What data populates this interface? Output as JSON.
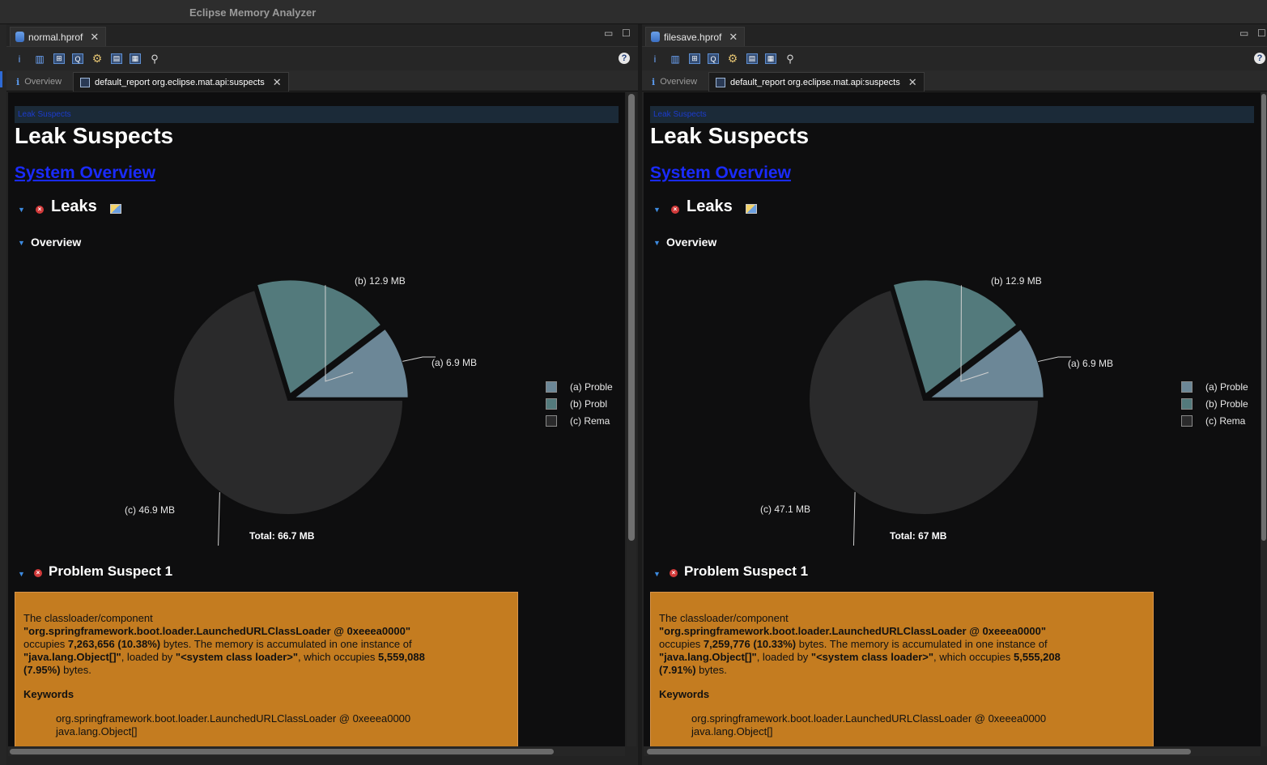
{
  "app": {
    "title": "Eclipse Memory Analyzer"
  },
  "panes": [
    {
      "file_tab": "normal.hprof",
      "subtabs": {
        "overview": "Overview",
        "report": "default_report org.eclipse.mat.api:suspects"
      },
      "breadcrumb": "Leak Suspects",
      "heading": "Leak Suspects",
      "system_overview_link": "System Overview",
      "leaks_heading": "Leaks",
      "overview_heading": "Overview",
      "chart_data": {
        "type": "pie",
        "slices": [
          {
            "label": "(a)",
            "value": 6.9,
            "display": "6.9 MB",
            "color": "#6c8797"
          },
          {
            "label": "(b)",
            "value": 12.9,
            "display": "12.9 MB",
            "color": "#537a7c"
          },
          {
            "label": "(c)",
            "value": 46.9,
            "display": "46.9 MB",
            "color": "#2a2a2b"
          }
        ],
        "legend": [
          "(a)  Proble",
          "(b)  Probl",
          "(c)  Rema"
        ],
        "total": "Total: 66.7 MB"
      },
      "suspect_heading": "Problem Suspect 1",
      "suspect": {
        "t1": "The classloader/component",
        "b1": "\"org.springframework.boot.loader.LaunchedURLClassLoader @ 0xeeea0000\"",
        "t2": "occupies ",
        "b2": "7,263,656 (10.38%)",
        "t3": " bytes. The memory is accumulated in one instance of",
        "b3": "\"java.lang.Object[]\"",
        "t4": ", loaded by ",
        "b4": "\"<system class loader>\"",
        "t5": ", which occupies ",
        "b5": "5,559,088",
        "b6": "(7.95%)",
        "t6": " bytes.",
        "keywords_title": "Keywords",
        "kw1": "org.springframework.boot.loader.LaunchedURLClassLoader @ 0xeeea0000",
        "kw2": "java.lang.Object[]"
      }
    },
    {
      "file_tab": "filesave.hprof",
      "subtabs": {
        "overview": "Overview",
        "report": "default_report org.eclipse.mat.api:suspects"
      },
      "breadcrumb": "Leak Suspects",
      "heading": "Leak Suspects",
      "system_overview_link": "System Overview",
      "leaks_heading": "Leaks",
      "overview_heading": "Overview",
      "chart_data": {
        "type": "pie",
        "slices": [
          {
            "label": "(a)",
            "value": 6.9,
            "display": "6.9 MB",
            "color": "#6c8797"
          },
          {
            "label": "(b)",
            "value": 12.9,
            "display": "12.9 MB",
            "color": "#537a7c"
          },
          {
            "label": "(c)",
            "value": 47.1,
            "display": "47.1 MB",
            "color": "#2a2a2b"
          }
        ],
        "legend": [
          "(a)  Proble",
          "(b)  Proble",
          "(c)  Rema"
        ],
        "total": "Total: 67 MB"
      },
      "suspect_heading": "Problem Suspect 1",
      "suspect": {
        "t1": "The classloader/component",
        "b1": "\"org.springframework.boot.loader.LaunchedURLClassLoader @ 0xeeea0000\"",
        "t2": "occupies ",
        "b2": "7,259,776 (10.33%)",
        "t3": " bytes. The memory is accumulated in one instance of",
        "b3": "\"java.lang.Object[]\"",
        "t4": ", loaded by ",
        "b4": "\"<system class loader>\"",
        "t5": ", which occupies ",
        "b5": "5,555,208",
        "b6": "(7.91%)",
        "t6": " bytes.",
        "keywords_title": "Keywords",
        "kw1": "org.springframework.boot.loader.LaunchedURLClassLoader @ 0xeeea0000",
        "kw2": "java.lang.Object[]"
      }
    }
  ]
}
